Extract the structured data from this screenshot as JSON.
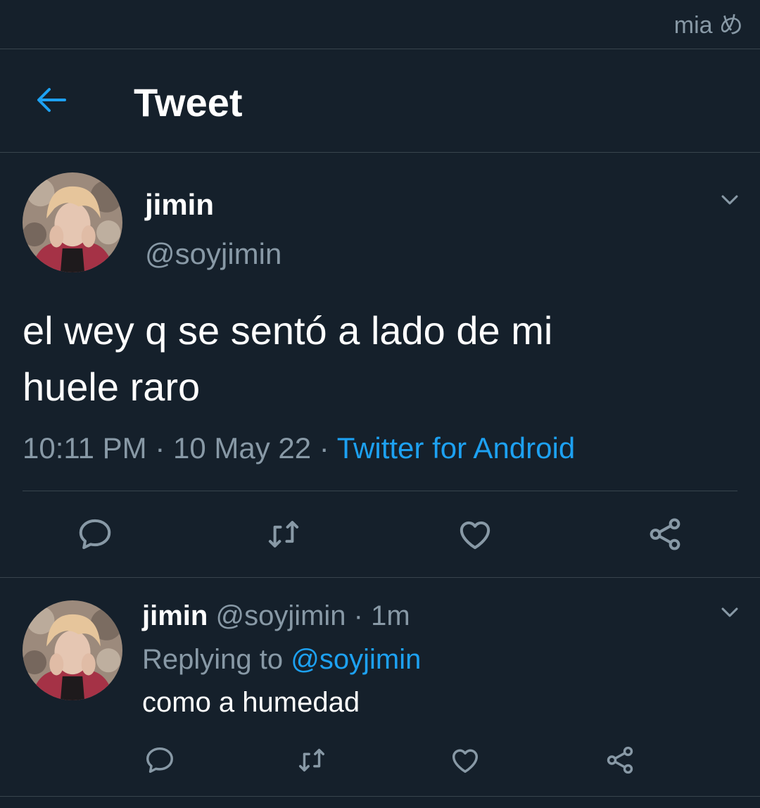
{
  "watermark": "mia め",
  "header": {
    "title": "Tweet",
    "back_icon": "arrow-left-icon"
  },
  "tweet": {
    "display_name": "jimin",
    "handle": "@soyjimin",
    "text_line1": "el wey q se sentó a lado de mi",
    "text_line2": "huele raro",
    "time": "10:11 PM",
    "date": "10 May 22",
    "separator": "·",
    "source": "Twitter for Android",
    "actions": [
      "reply-icon",
      "retweet-icon",
      "like-icon",
      "share-icon"
    ]
  },
  "reply": {
    "display_name": "jimin",
    "handle": "@soyjimin",
    "separator": "·",
    "age": "1m",
    "replying_prefix": "Replying to",
    "replying_to": "@soyjimin",
    "text": "como a humedad",
    "actions": [
      "reply-icon",
      "retweet-icon",
      "like-icon",
      "share-icon"
    ]
  },
  "colors": {
    "background": "#15202b",
    "divider": "#38444d",
    "muted_text": "#8899a6",
    "accent": "#1da1f2",
    "text": "#ffffff"
  }
}
